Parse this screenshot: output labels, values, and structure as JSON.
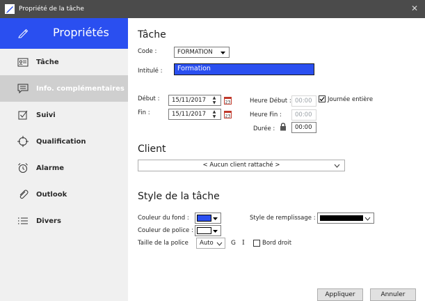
{
  "window": {
    "title": "Propriété de la tâche",
    "close_glyph": "✕"
  },
  "sidebar": {
    "header_label": "Propriétés",
    "items": [
      {
        "label": "Tâche",
        "icon": "id-card-icon"
      },
      {
        "label": "Info. complémentaires",
        "icon": "comment-icon"
      },
      {
        "label": "Suivi",
        "icon": "checkbox-icon"
      },
      {
        "label": "Qualification",
        "icon": "target-icon"
      },
      {
        "label": "Alarme",
        "icon": "alarm-clock-icon"
      },
      {
        "label": "Outlook",
        "icon": "paperclip-icon"
      },
      {
        "label": "Divers",
        "icon": "list-icon"
      }
    ]
  },
  "tache": {
    "heading": "Tâche",
    "code_label": "Code :",
    "code_value": "FORMATION",
    "intitule_label": "Intitulé :",
    "intitule_value": "Formation"
  },
  "dates": {
    "debut_label": "Début :",
    "debut_value": "15/11/2017",
    "fin_label": "Fin :",
    "fin_value": "15/11/2017",
    "heure_debut_label": "Heure Début :",
    "heure_debut_value": "00:00",
    "heure_fin_label": "Heure Fin :",
    "heure_fin_value": "00:00",
    "journee_label": "Journée entière",
    "journee_checked": true,
    "duree_label": "Durée :",
    "duree_value": "00:00"
  },
  "client": {
    "heading": "Client",
    "select_value": "< Aucun client rattaché >"
  },
  "style": {
    "heading": "Style de la tâche",
    "couleur_fond_label": "Couleur du fond :",
    "couleur_fond": "#2a4ff0",
    "couleur_police_label": "Couleur de police :",
    "couleur_police": "#ffffff",
    "remplissage_label": "Style de remplissage :",
    "remplissage_color": "#000000",
    "taille_label": "Taille de la police",
    "taille_value": "Auto",
    "gras_label": "G",
    "italique_label": "I",
    "bord_droit_label": "Bord droit",
    "bord_droit_checked": false
  },
  "buttons": {
    "appliquer": "Appliquer",
    "annuler": "Annuler"
  },
  "colors": {
    "accent": "#2a4ff0",
    "titlebar": "#4b4b4b",
    "sidebar_bg": "#f0f0f0"
  }
}
